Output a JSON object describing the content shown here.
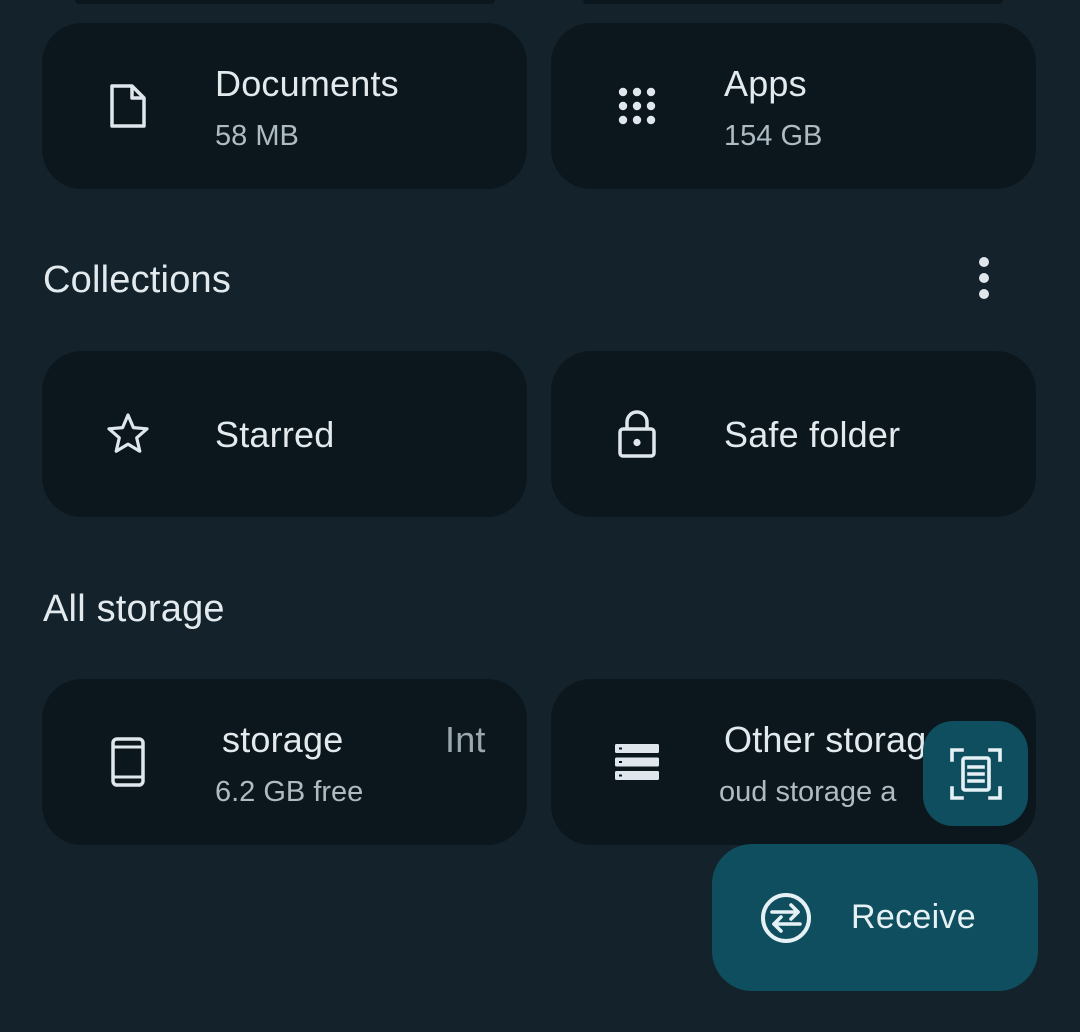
{
  "categories": [
    {
      "title": "Documents",
      "size": "58 MB",
      "icon": "document-icon"
    },
    {
      "title": "Apps",
      "size": "154 GB",
      "icon": "apps-grid-icon"
    }
  ],
  "collections": {
    "title": "Collections",
    "items": [
      {
        "title": "Starred",
        "icon": "star-icon"
      },
      {
        "title": "Safe folder",
        "icon": "lock-icon"
      }
    ]
  },
  "all_storage": {
    "title": "All storage",
    "items": [
      {
        "title_main": "storage",
        "title_scroll": "Int",
        "sub": "6.2 GB free",
        "icon": "phone-icon"
      },
      {
        "title": "Other storag",
        "sub": "oud storage a",
        "icon": "storage-list-icon"
      }
    ]
  },
  "fab": {
    "scan_icon": "document-scan-icon",
    "receive_label": "Receive",
    "receive_icon": "receive-exchange-icon"
  },
  "colors": {
    "background": "#13222b",
    "card": "#0c171d",
    "fab": "#0f4e5e",
    "text": "#e3eaee",
    "subtext": "#aebbc2"
  }
}
